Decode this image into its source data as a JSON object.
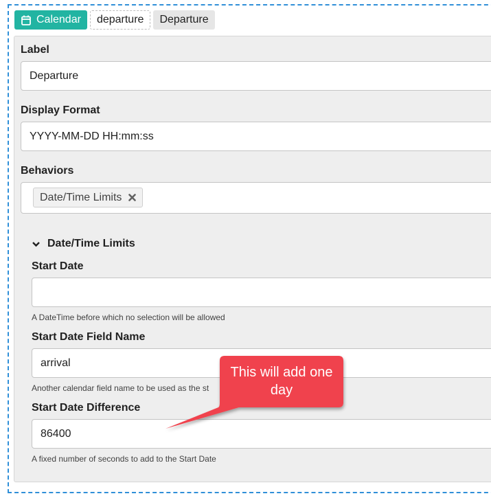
{
  "header": {
    "type_label": "Calendar",
    "field_name": "departure",
    "field_label": "Departure"
  },
  "form": {
    "label": {
      "title": "Label",
      "value": "Departure"
    },
    "display_format": {
      "title": "Display Format",
      "value": "YYYY-MM-DD HH:mm:ss"
    },
    "behaviors": {
      "title": "Behaviors",
      "chips": [
        "Date/Time Limits"
      ]
    }
  },
  "limits": {
    "section_title": "Date/Time Limits",
    "start_date": {
      "title": "Start Date",
      "value": "",
      "help": "A DateTime before which no selection will be allowed"
    },
    "start_field": {
      "title": "Start Date Field Name",
      "value": "arrival",
      "help": "Another calendar field name to be used as the st"
    },
    "start_diff": {
      "title": "Start Date Difference",
      "value": "86400",
      "help": "A fixed number of seconds to add to the Start Date"
    }
  },
  "annotation": {
    "text": "This will add one day",
    "color": "#f0434d"
  },
  "colors": {
    "accent": "#22b4a2",
    "frame": "#2f8fd8"
  }
}
